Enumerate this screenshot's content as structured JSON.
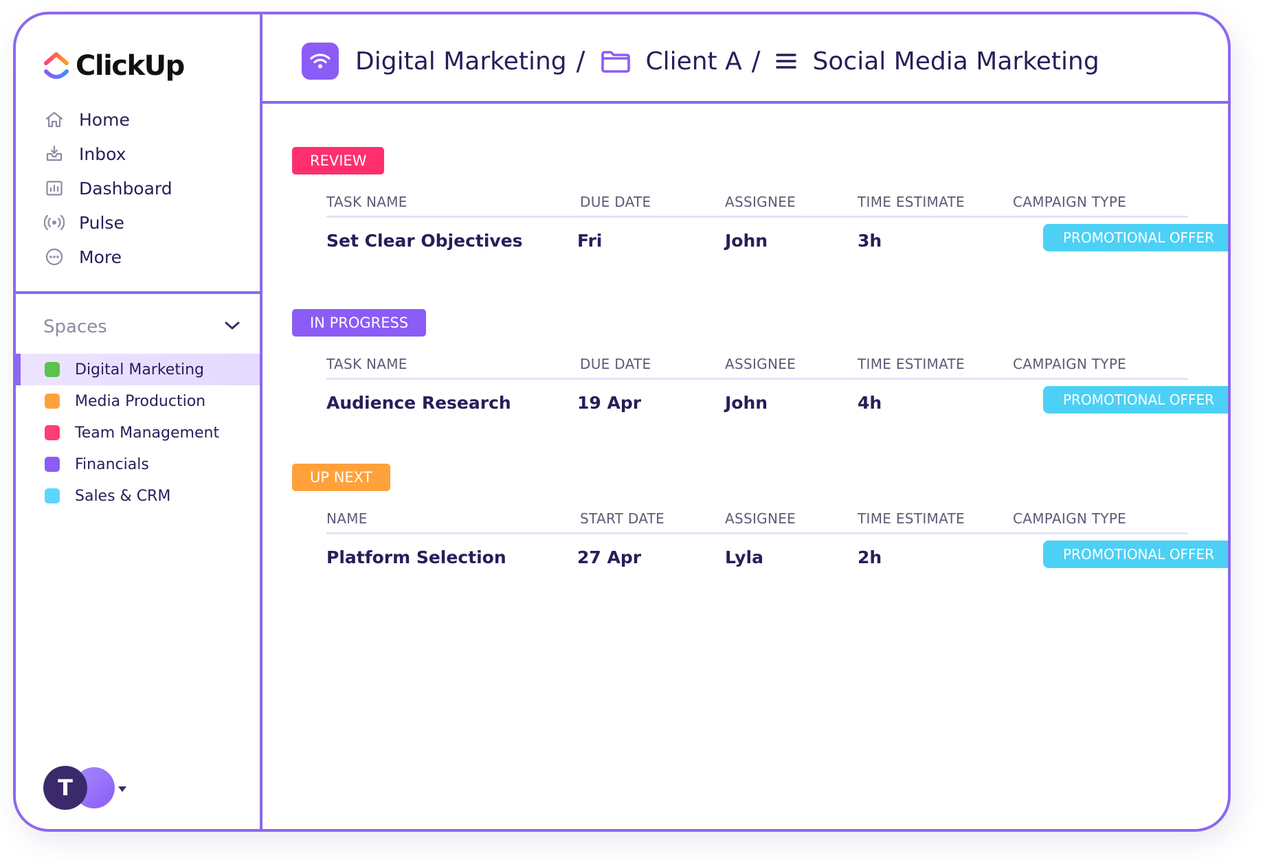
{
  "app": {
    "name": "ClickUp",
    "brand_colors": {
      "accent": "#8b68f0",
      "logo_pink": "#ff3c80",
      "logo_orange": "#ff9b1a",
      "logo_blue": "#3c8dff"
    }
  },
  "sidebar": {
    "nav": [
      {
        "label": "Home",
        "icon": "home-icon"
      },
      {
        "label": "Inbox",
        "icon": "inbox-icon"
      },
      {
        "label": "Dashboard",
        "icon": "dashboard-icon"
      },
      {
        "label": "Pulse",
        "icon": "pulse-icon"
      },
      {
        "label": "More",
        "icon": "more-icon"
      }
    ],
    "spaces_title": "Spaces",
    "spaces": [
      {
        "label": "Digital Marketing",
        "color": "#5ac34f",
        "active": true
      },
      {
        "label": "Media Production",
        "color": "#ffa13b",
        "active": false
      },
      {
        "label": "Team Management",
        "color": "#ff3d77",
        "active": false
      },
      {
        "label": "Financials",
        "color": "#8b5cf6",
        "active": false
      },
      {
        "label": "Sales & CRM",
        "color": "#5cd6ff",
        "active": false
      }
    ],
    "user_initial": "T"
  },
  "breadcrumb": [
    {
      "label": "Digital Marketing",
      "icon": "wifi-icon"
    },
    {
      "label": "Client A",
      "icon": "folder-icon"
    },
    {
      "label": "Social Media Marketing",
      "icon": "list-icon"
    }
  ],
  "breadcrumb_separator": "/",
  "groups": [
    {
      "status": "REVIEW",
      "status_color": "#ff2f6e",
      "columns": [
        "TASK NAME",
        "DUE DATE",
        "ASSIGNEE",
        "TIME ESTIMATE",
        "CAMPAIGN TYPE"
      ],
      "task": {
        "name": "Set Clear Objectives",
        "date": "Fri",
        "assignee": "John",
        "estimate": "3h",
        "campaign": "PROMOTIONAL OFFER"
      }
    },
    {
      "status": "IN PROGRESS",
      "status_color": "#8b5cf6",
      "columns": [
        "TASK NAME",
        "DUE DATE",
        "ASSIGNEE",
        "TIME ESTIMATE",
        "CAMPAIGN TYPE"
      ],
      "task": {
        "name": "Audience Research",
        "date": "19 Apr",
        "assignee": "John",
        "estimate": "4h",
        "campaign": "PROMOTIONAL OFFER"
      }
    },
    {
      "status": "UP NEXT",
      "status_color": "#ffa13b",
      "columns": [
        "NAME",
        "START DATE",
        "ASSIGNEE",
        "TIME ESTIMATE",
        "CAMPAIGN TYPE"
      ],
      "task": {
        "name": "Platform Selection",
        "date": "27 Apr",
        "assignee": "Lyla",
        "estimate": "2h",
        "campaign": "PROMOTIONAL OFFER"
      }
    }
  ]
}
